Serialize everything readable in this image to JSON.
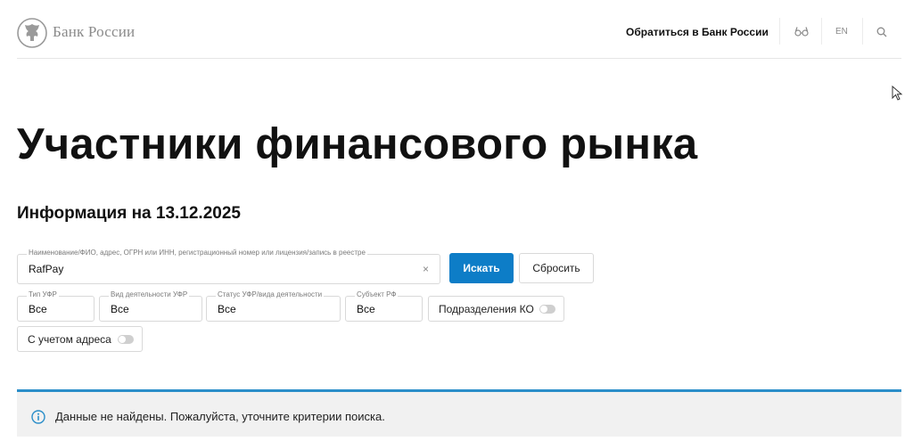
{
  "header": {
    "brand": "Банк России",
    "contact_link": "Обратиться в Банк России",
    "lang_label": "EN",
    "icons": [
      "bank-emblem-icon",
      "glasses-icon",
      "search-icon"
    ]
  },
  "main": {
    "title": "Участники финансового рынка",
    "info_heading": "Информация на 13.12.2025"
  },
  "search": {
    "label": "Наименование/ФИО, адрес, ОГРН или ИНН, регистрационный номер или лицензия/запись в реестре",
    "value": "RafPay",
    "clear_icon": "×",
    "search_button": "Искать",
    "reset_button": "Сбросить"
  },
  "filters": {
    "ufr_type": {
      "label": "Тип УФР",
      "value": "Все"
    },
    "activity_type": {
      "label": "Вид деятельности УФР",
      "value": "Все"
    },
    "status": {
      "label": "Статус УФР/вида деятельности",
      "value": "Все"
    },
    "region": {
      "label": "Субъект РФ",
      "value": "Все"
    },
    "ko_divisions": {
      "label": "Подразделения КО",
      "enabled": false
    },
    "address": {
      "label": "С учетом адреса",
      "enabled": false
    }
  },
  "notice": {
    "text": "Данные не найдены. Пожалуйста, уточните критерии поиска.",
    "icon": "info-icon"
  },
  "colors": {
    "primary": "#0d7dc7",
    "notice_border": "#2b8ec9",
    "notice_bg": "#f1f1f1"
  }
}
